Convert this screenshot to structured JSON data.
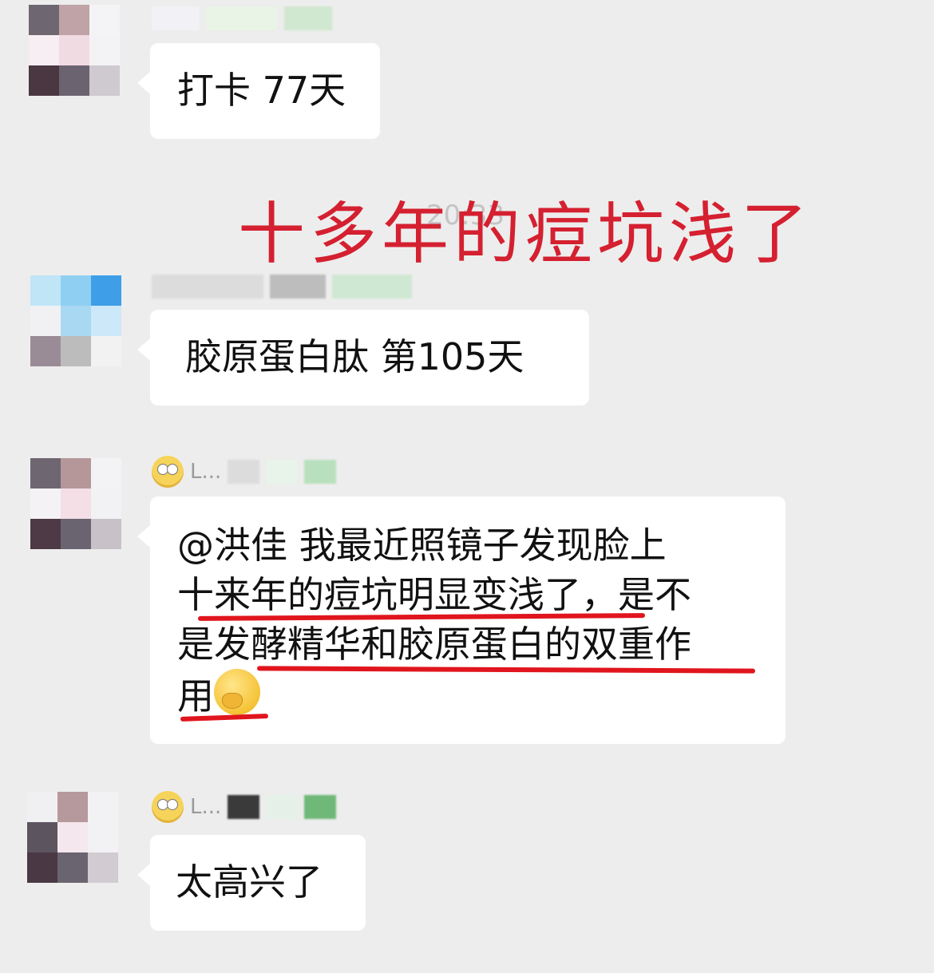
{
  "messages": [
    {
      "sender": "",
      "text": "打卡 77天"
    },
    {
      "sender": "",
      "text": "胶原蛋白肽 第105天"
    },
    {
      "sender": "L...",
      "lines": [
        "@洪佳 我最近照镜子发现脸上",
        "十来年的痘坑明显变浅了，是不",
        "是发酵精华和胶原蛋白的双重作",
        "用"
      ]
    },
    {
      "sender": "L...",
      "text": "太高兴了"
    }
  ],
  "timestamp": "20:33",
  "headline": "十多年的痘坑浅了",
  "colors": {
    "background": "#ededed",
    "bubble": "#ffffff",
    "headline": "#d42030",
    "underline": "#e0151d"
  },
  "icons": [
    "eye-roll-emoji-icon",
    "hugging-face-emoji-icon",
    "panda-icon"
  ]
}
